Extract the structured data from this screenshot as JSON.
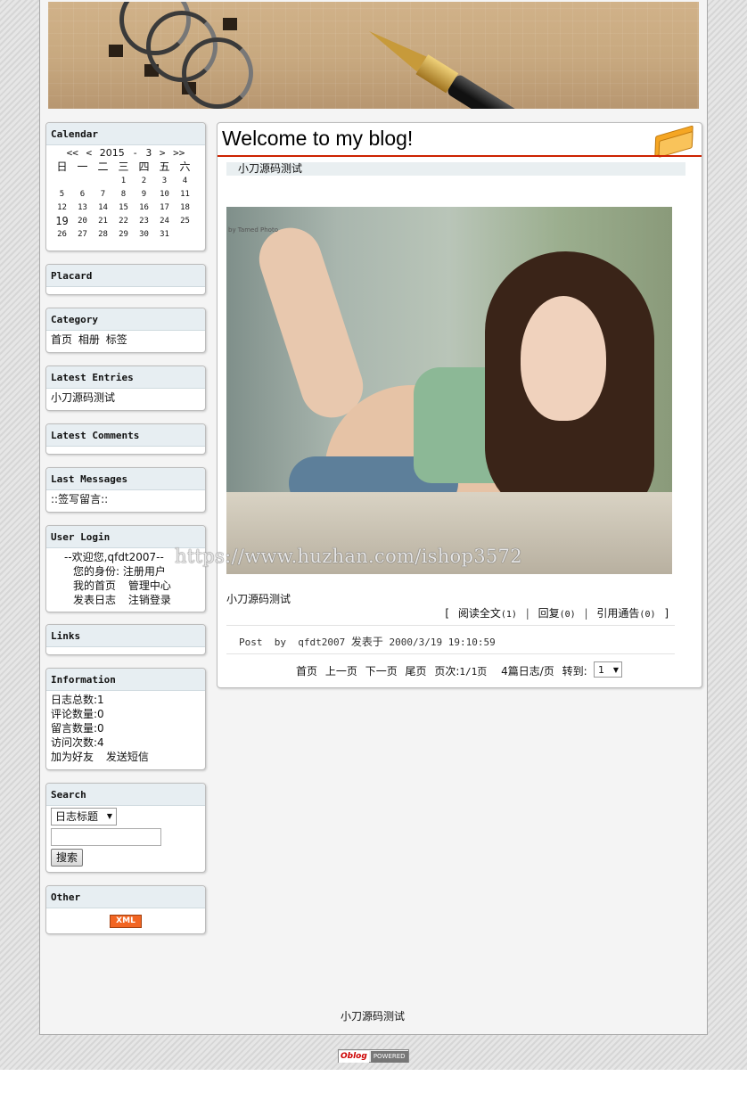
{
  "calendar": {
    "title": "Calendar",
    "prev_year": "<<",
    "prev_month": "<",
    "year": "2015",
    "dash": "-",
    "month": "3",
    "next_month": ">",
    "next_year": ">>",
    "weekdays": [
      "日",
      "一",
      "二",
      "三",
      "四",
      "五",
      "六"
    ],
    "weeks": [
      [
        "",
        "",
        "",
        "1",
        "2",
        "3",
        "4"
      ],
      [
        "5",
        "6",
        "7",
        "8",
        "9",
        "10",
        "11"
      ],
      [
        "12",
        "13",
        "14",
        "15",
        "16",
        "17",
        "18"
      ],
      [
        "19",
        "20",
        "21",
        "22",
        "23",
        "24",
        "25"
      ],
      [
        "26",
        "27",
        "28",
        "29",
        "30",
        "31",
        ""
      ]
    ]
  },
  "placard": {
    "title": "Placard"
  },
  "category": {
    "title": "Category",
    "links": [
      "首页",
      "相册",
      "标签"
    ]
  },
  "latest_entries": {
    "title": "Latest Entries",
    "items": [
      "小刀源码测试"
    ]
  },
  "latest_comments": {
    "title": "Latest Comments"
  },
  "last_messages": {
    "title": "Last Messages",
    "link": "::签写留言::"
  },
  "user_login": {
    "title": "User Login",
    "welcome": "--欢迎您,qfdt2007--",
    "identity": "您的身份: 注册用户",
    "my_home": "我的首页",
    "admin_center": "管理中心",
    "post_log": "发表日志",
    "logout": "注销登录"
  },
  "links": {
    "title": "Links"
  },
  "information": {
    "title": "Information",
    "lines": [
      "日志总数:1",
      "评论数量:0",
      "留言数量:0",
      "访问次数:4"
    ],
    "add_friend": "加为好友",
    "send_message": "发送短信"
  },
  "search": {
    "title": "Search",
    "type_selected": "日志标题",
    "button": "搜索",
    "input_value": ""
  },
  "other": {
    "title": "Other",
    "xml_badge": "XML"
  },
  "main": {
    "title": "Welcome to my blog!",
    "post_title": "小刀源码测试",
    "photo_caption": "by Tamed Photo",
    "watermark": "https://www.huzhan.com/ishop3572",
    "summary": "小刀源码测试",
    "read_more": "阅读全文",
    "read_more_count": "(1)",
    "reply": "回复",
    "reply_count": "(0)",
    "trackback": "引用通告",
    "trackback_count": "(0)",
    "bracket_open": "[",
    "bracket_close": "]",
    "sep": "|",
    "meta_post": "Post",
    "meta_by": "by",
    "meta_author": "qfdt2007",
    "meta_posted_at": "发表于",
    "meta_datetime": "2000/3/19 19:10:59"
  },
  "pager": {
    "first": "首页",
    "prev": "上一页",
    "next": "下一页",
    "last": "尾页",
    "page_label": "页次:",
    "page_value": "1/1页",
    "per_page": "4篇日志/页",
    "goto_label": "转到:",
    "goto_selected": "1"
  },
  "footer": {
    "text": "小刀源码测试",
    "powered_logo": "Oblog",
    "powered_text": "POWERED"
  },
  "colors": {
    "accent_red": "#cc2200",
    "box_header": "#e7eef2"
  }
}
